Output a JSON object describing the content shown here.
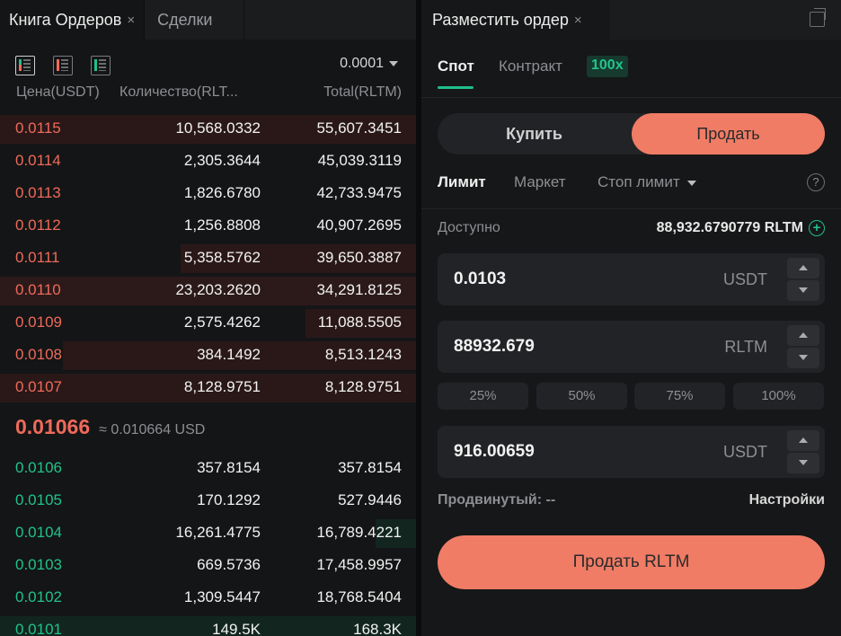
{
  "orderbook": {
    "tabs": [
      {
        "label": "Книга Ордеров",
        "close": "×"
      },
      {
        "label": "Сделки"
      }
    ],
    "precision": "0.0001",
    "columns": {
      "price": "Цена(USDT)",
      "quantity": "Количество(RLT...",
      "total": "Total(RLTM)"
    },
    "asks": [
      {
        "price": "0.0115",
        "qty": "10,568.0332",
        "total": "55,607.3451"
      },
      {
        "price": "0.0114",
        "qty": "2,305.3644",
        "total": "45,039.3119"
      },
      {
        "price": "0.0113",
        "qty": "1,826.6780",
        "total": "42,733.9475"
      },
      {
        "price": "0.0112",
        "qty": "1,256.8808",
        "total": "40,907.2695"
      },
      {
        "price": "0.0111",
        "qty": "5,358.5762",
        "total": "39,650.3887"
      },
      {
        "price": "0.0110",
        "qty": "23,203.2620",
        "total": "34,291.8125"
      },
      {
        "price": "0.0109",
        "qty": "2,575.4262",
        "total": "11,088.5505"
      },
      {
        "price": "0.0108",
        "qty": "384.1492",
        "total": "8,513.1243"
      },
      {
        "price": "0.0107",
        "qty": "8,128.9751",
        "total": "8,128.9751"
      }
    ],
    "last_price": "0.01066",
    "last_price_usd": "≈ 0.010664 USD",
    "bids": [
      {
        "price": "0.0106",
        "qty": "357.8154",
        "total": "357.8154"
      },
      {
        "price": "0.0105",
        "qty": "170.1292",
        "total": "527.9446"
      },
      {
        "price": "0.0104",
        "qty": "16,261.4775",
        "total": "16,789.4221"
      },
      {
        "price": "0.0103",
        "qty": "669.5736",
        "total": "17,458.9957"
      },
      {
        "price": "0.0102",
        "qty": "1,309.5447",
        "total": "18,768.5404"
      },
      {
        "price": "0.0101",
        "qty": "149.5K",
        "total": "168.3K"
      }
    ]
  },
  "order_form": {
    "tab": {
      "label": "Разместить ордер",
      "close": "×"
    },
    "market_tabs": {
      "spot": "Спот",
      "contract": "Контракт",
      "leverage": "100x"
    },
    "side": {
      "buy": "Купить",
      "sell": "Продать"
    },
    "order_types": {
      "limit": "Лимит",
      "market": "Маркет",
      "stop_limit": "Стоп лимит"
    },
    "help": "?",
    "available": {
      "label": "Доступно",
      "value": "88,932.6790779 RLTM"
    },
    "price_field": {
      "value": "0.0103",
      "unit": "USDT"
    },
    "amount_field": {
      "value": "88932.679",
      "unit": "RLTM"
    },
    "percent_buttons": [
      "25%",
      "50%",
      "75%",
      "100%"
    ],
    "total_field": {
      "value": "916.00659",
      "unit": "USDT"
    },
    "advanced": {
      "label": "Продвинутый: --",
      "settings": "Настройки"
    },
    "submit": "Продать RLTM"
  },
  "colors": {
    "ask": "#ef6a5a",
    "bid": "#20c28b",
    "accent_sell": "#f07c66",
    "accent_green": "#1ec08a"
  }
}
